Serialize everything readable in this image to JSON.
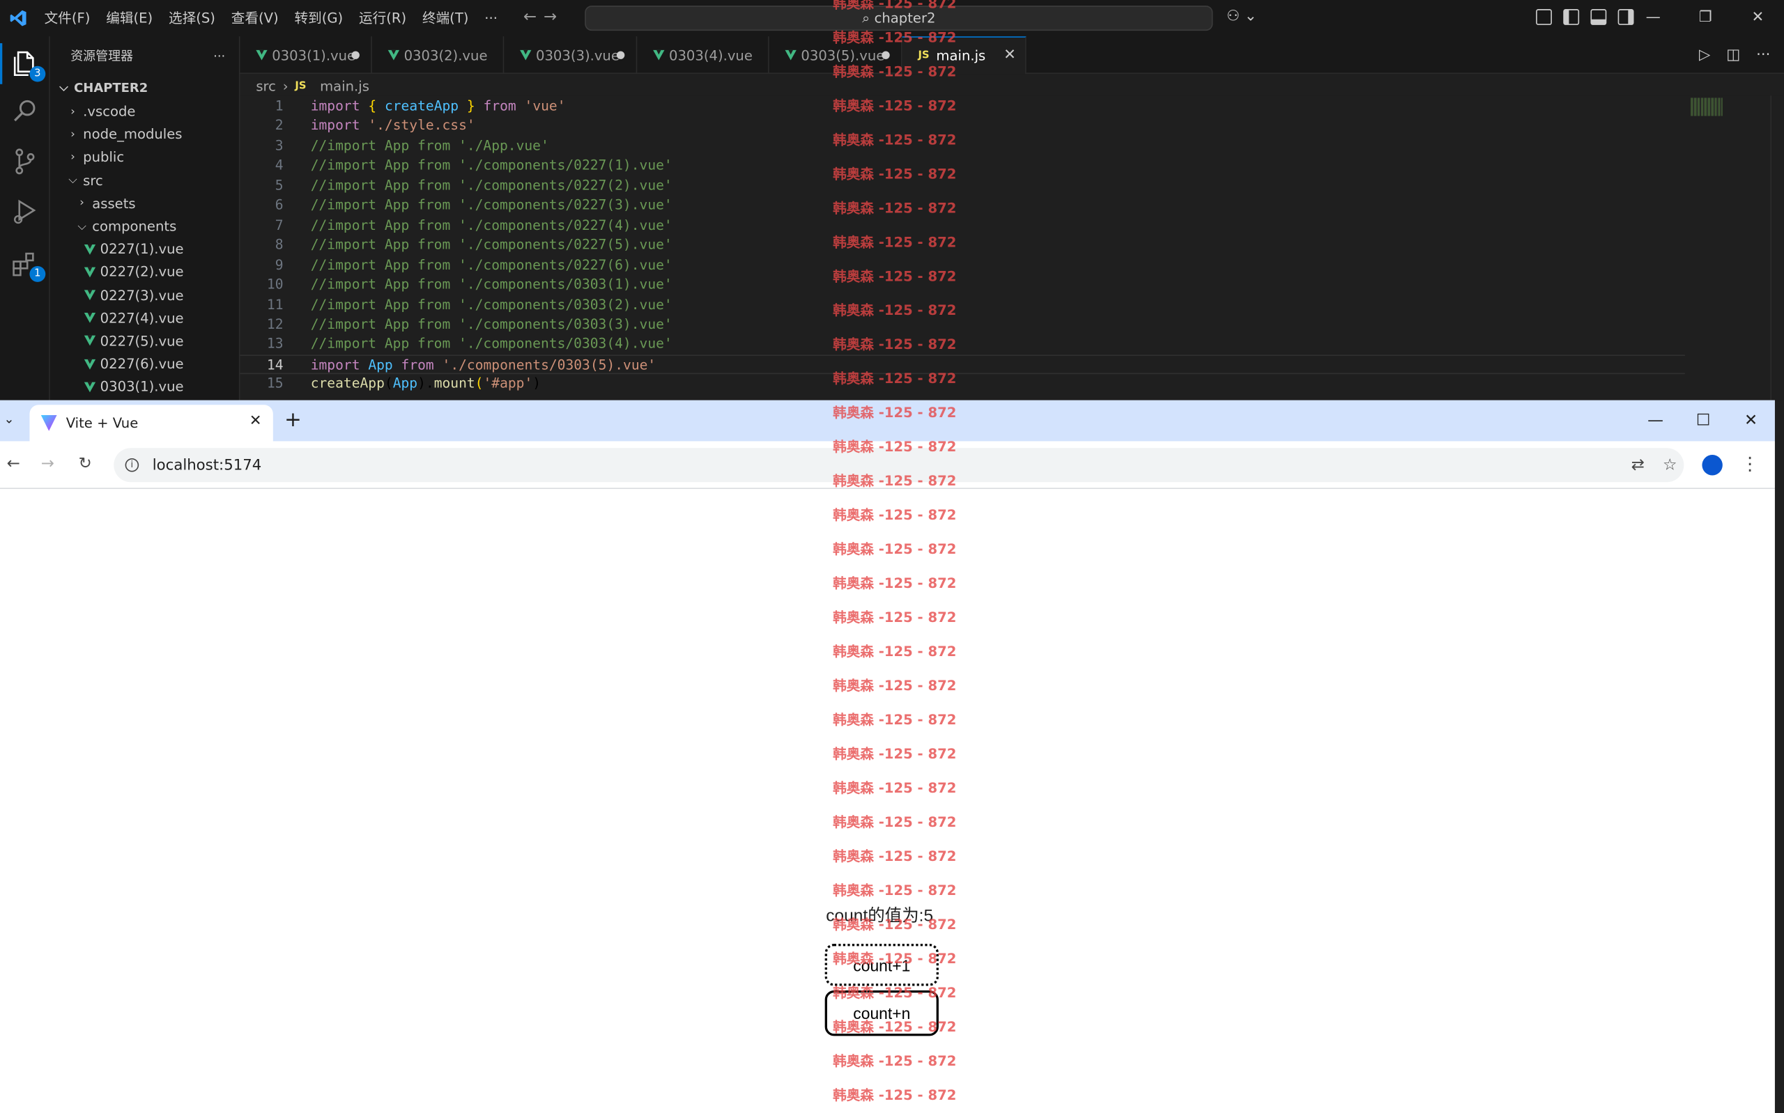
{
  "vscode": {
    "menus": [
      "文件(F)",
      "编辑(E)",
      "选择(S)",
      "查看(V)",
      "转到(G)",
      "运行(R)",
      "终端(T)",
      "···"
    ],
    "search_text": "chapter2",
    "badges": {
      "explorer": "3",
      "extensions": "1"
    },
    "explorer": {
      "title": "资源管理器",
      "more": "···",
      "project": "CHAPTER2",
      "items": [
        {
          "label": ".vscode",
          "type": "folder",
          "open": false,
          "indent": 0
        },
        {
          "label": "node_modules",
          "type": "folder",
          "open": false,
          "indent": 0
        },
        {
          "label": "public",
          "type": "folder",
          "open": false,
          "indent": 0
        },
        {
          "label": "src",
          "type": "folder",
          "open": true,
          "indent": 0
        },
        {
          "label": "assets",
          "type": "folder",
          "open": false,
          "indent": 1
        },
        {
          "label": "components",
          "type": "folder",
          "open": true,
          "indent": 1
        },
        {
          "label": "0227(1).vue",
          "type": "vue",
          "indent": 2
        },
        {
          "label": "0227(2).vue",
          "type": "vue",
          "indent": 2
        },
        {
          "label": "0227(3).vue",
          "type": "vue",
          "indent": 2
        },
        {
          "label": "0227(4).vue",
          "type": "vue",
          "indent": 2
        },
        {
          "label": "0227(5).vue",
          "type": "vue",
          "indent": 2
        },
        {
          "label": "0227(6).vue",
          "type": "vue",
          "indent": 2
        },
        {
          "label": "0303(1).vue",
          "type": "vue",
          "indent": 2
        }
      ]
    },
    "tabs": [
      {
        "label": "0303(1).vue",
        "modified": true
      },
      {
        "label": "0303(2).vue",
        "modified": false
      },
      {
        "label": "0303(3).vue",
        "modified": true
      },
      {
        "label": "0303(4).vue",
        "modified": false
      },
      {
        "label": "0303(5).vue",
        "modified": true
      },
      {
        "label": "main.js",
        "active": true
      }
    ],
    "breadcrumb": {
      "folder": "src",
      "file": "main.js",
      "file_icon": "JS"
    },
    "code_lines": [
      "import { createApp } from 'vue'",
      "import './style.css'",
      "//import App from './App.vue'",
      "//import App from './components/0227(1).vue'",
      "//import App from './components/0227(2).vue'",
      "//import App from './components/0227(3).vue'",
      "//import App from './components/0227(4).vue'",
      "//import App from './components/0227(5).vue'",
      "//import App from './components/0227(6).vue'",
      "//import App from './components/0303(1).vue'",
      "//import App from './components/0303(2).vue'",
      "//import App from './components/0303(3).vue'",
      "//import App from './components/0303(4).vue'",
      "import App from './components/0303(5).vue'",
      "createApp(App).mount('#app')"
    ],
    "current_line": 14
  },
  "browser": {
    "tab_title": "Vite + Vue",
    "new_tab": "+",
    "url": "localhost:5174",
    "page": {
      "count_text": "count的值为:5",
      "btn_increment": "count+1",
      "btn_increment_n": "count+n"
    }
  },
  "watermark": {
    "text": "韩奥森 -125 - 872",
    "color": "#e64646"
  }
}
